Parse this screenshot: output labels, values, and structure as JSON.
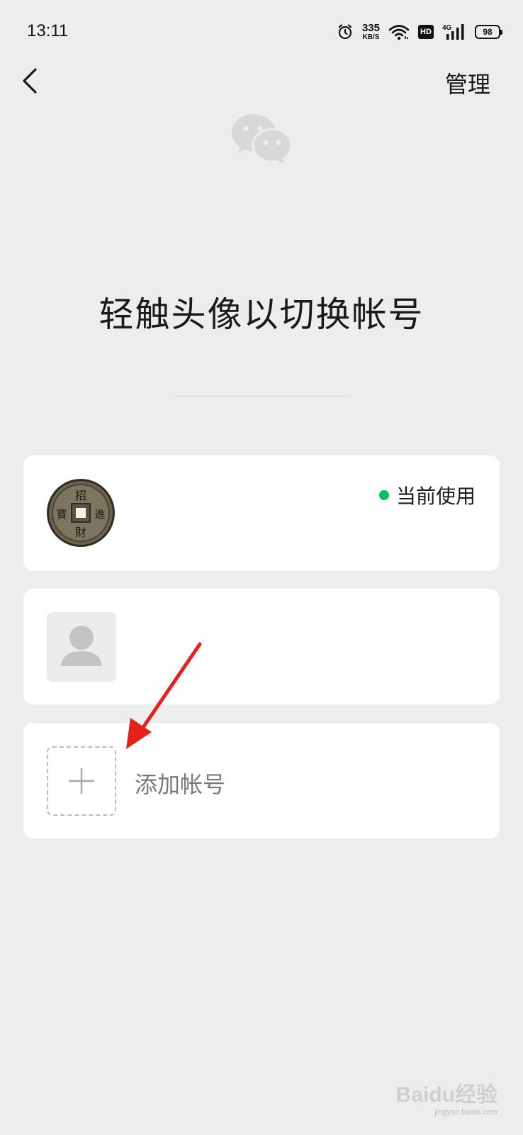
{
  "status_bar": {
    "time": "13:11",
    "net_speed_value": "335",
    "net_speed_unit": "KB/S",
    "hd": "HD",
    "network": "4G",
    "battery": "98",
    "icons": [
      "alarm-icon",
      "wifi-icon",
      "hd-icon",
      "signal-icon",
      "battery-icon"
    ]
  },
  "nav": {
    "back_icon": "chevron-left-icon",
    "manage_label": "管理"
  },
  "logo_icon": "wechat-icon",
  "title": "轻触头像以切换帐号",
  "accounts": [
    {
      "avatar_icon": "coin-avatar",
      "avatar_text": "招進財寶",
      "status": "当前使用",
      "status_color": "#07c160"
    },
    {
      "avatar_icon": "default-user-icon"
    }
  ],
  "add_account": {
    "icon": "plus-icon",
    "label": "添加帐号"
  },
  "annotation": {
    "icon": "red-arrow-icon",
    "color": "#e8201c"
  },
  "watermark": {
    "text": "Baidu经验",
    "url": "jingyan.baidu.com"
  },
  "colors": {
    "background": "#ededed",
    "card": "#ffffff",
    "accent_green": "#07c160"
  }
}
